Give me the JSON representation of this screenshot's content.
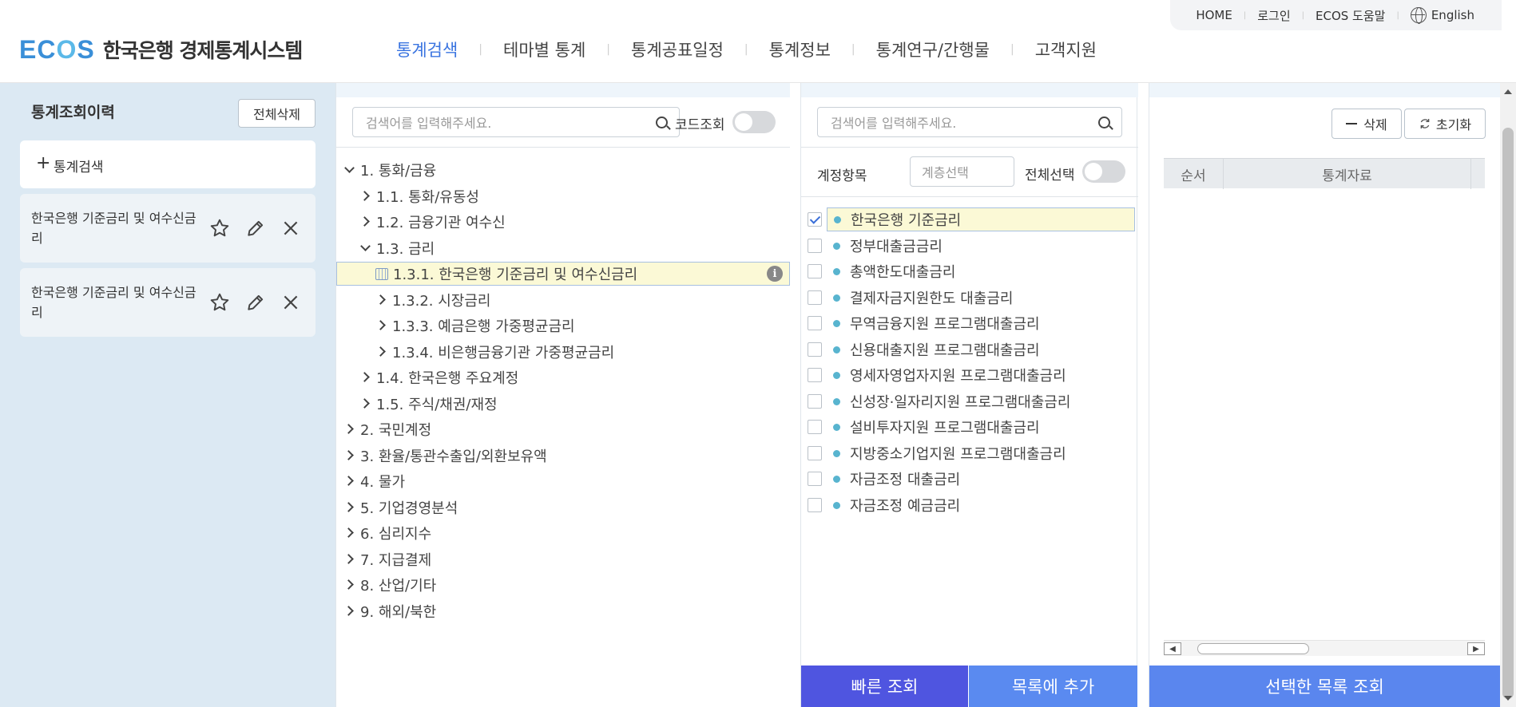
{
  "header": {
    "logo_mark_pre": "EC",
    "logo_mark_o": "O",
    "logo_mark_post": "S",
    "logo_text": "한국은행 경제통계시스템",
    "util": {
      "home": "HOME",
      "login": "로그인",
      "help": "ECOS 도움말",
      "english": "English"
    },
    "nav": [
      {
        "label": "통계검색",
        "active": true
      },
      {
        "label": "테마별 통계"
      },
      {
        "label": "통계공표일정"
      },
      {
        "label": "통계정보"
      },
      {
        "label": "통계연구/간행물"
      },
      {
        "label": "고객지원"
      }
    ]
  },
  "history": {
    "title": "통계조회이력",
    "delete_all": "전체삭제",
    "add_search": "통계검색",
    "items": [
      {
        "label": "한국은행 기준금리 및 여수신금리"
      },
      {
        "label": "한국은행 기준금리 및 여수신금리"
      }
    ]
  },
  "tree": {
    "search_placeholder": "검색어를 입력해주세요.",
    "code_toggle_label": "코드조회",
    "rows": [
      {
        "label": "1. 통화/금융",
        "level": 0,
        "expanded": true
      },
      {
        "label": "1.1. 통화/유동성",
        "level": 1
      },
      {
        "label": "1.2. 금융기관 여수신",
        "level": 1
      },
      {
        "label": "1.3. 금리",
        "level": 1,
        "expanded": true
      },
      {
        "label": "1.3.1. 한국은행 기준금리 및 여수신금리",
        "level": 2,
        "selected": true
      },
      {
        "label": "1.3.2. 시장금리",
        "level": 2
      },
      {
        "label": "1.3.3. 예금은행 가중평균금리",
        "level": 2
      },
      {
        "label": "1.3.4. 비은행금융기관 가중평균금리",
        "level": 2
      },
      {
        "label": "1.4. 한국은행 주요계정",
        "level": 1
      },
      {
        "label": "1.5. 주식/채권/재정",
        "level": 1
      },
      {
        "label": "2. 국민계정",
        "level": 0
      },
      {
        "label": "3. 환율/통관수출입/외환보유액",
        "level": 0
      },
      {
        "label": "4. 물가",
        "level": 0
      },
      {
        "label": "5. 기업경영분석",
        "level": 0
      },
      {
        "label": "6. 심리지수",
        "level": 0
      },
      {
        "label": "7. 지급결제",
        "level": 0
      },
      {
        "label": "8. 산업/기타",
        "level": 0
      },
      {
        "label": "9. 해외/북한",
        "level": 0
      }
    ]
  },
  "items_panel": {
    "search_placeholder": "검색어를 입력해주세요.",
    "account_label": "계정항목",
    "layer_placeholder": "계층선택",
    "select_all_label": "전체선택",
    "items": [
      {
        "label": "한국은행 기준금리",
        "checked": true
      },
      {
        "label": "정부대출금금리"
      },
      {
        "label": "총액한도대출금리"
      },
      {
        "label": "결제자금지원한도 대출금리"
      },
      {
        "label": "무역금융지원 프로그램대출금리"
      },
      {
        "label": "신용대출지원 프로그램대출금리"
      },
      {
        "label": "영세자영업자지원 프로그램대출금리"
      },
      {
        "label": "신성장·일자리지원 프로그램대출금리"
      },
      {
        "label": "설비투자지원 프로그램대출금리"
      },
      {
        "label": "지방중소기업지원 프로그램대출금리"
      },
      {
        "label": "자금조정 대출금리"
      },
      {
        "label": "자금조정 예금금리"
      }
    ],
    "quick_search": "빠른 조회",
    "add_to_list": "목록에 추가"
  },
  "selected_panel": {
    "delete": "삭제",
    "reset": "초기화",
    "col_order": "순서",
    "col_data": "통계자료",
    "query_selected": "선택한 목록 조회"
  },
  "colors": {
    "accent_blue": "#3a74e0",
    "btn_quick": "#4f55e0",
    "btn_add": "#5a8af0",
    "btn_query": "#5a86ee",
    "dot": "#58b4cf",
    "highlight": "#fbf9d6",
    "left_bg": "#dce9f3"
  }
}
